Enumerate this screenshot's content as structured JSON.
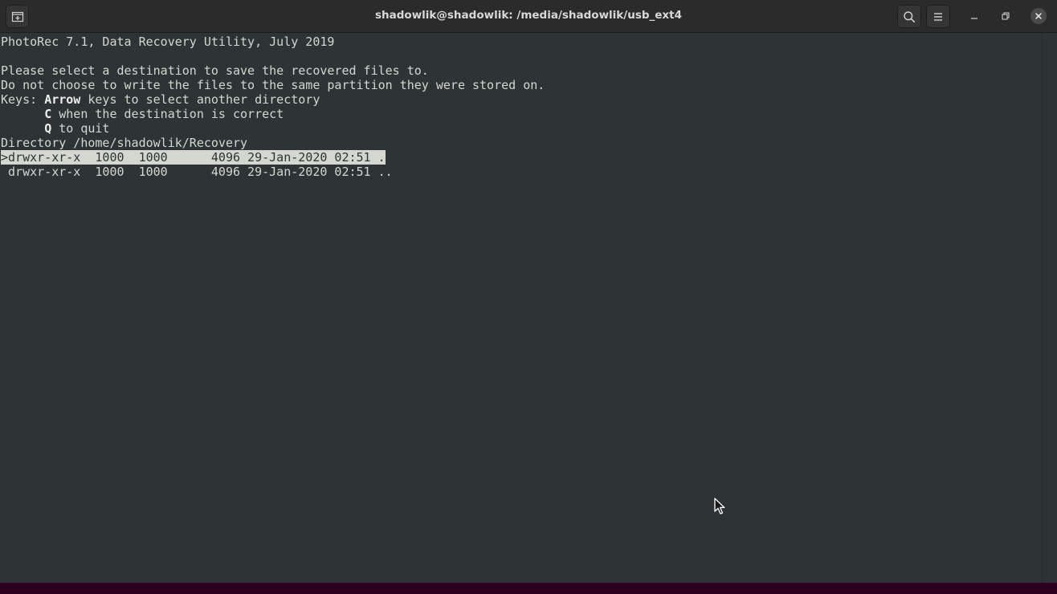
{
  "window": {
    "title": "shadowlik@shadowlik: /media/shadowlik/usb_ext4"
  },
  "icons": {
    "new_tab": "new-tab-icon",
    "search": "search-icon",
    "menu": "hamburger-menu-icon",
    "minimize": "minimize-icon",
    "maximize": "maximize-icon",
    "close": "close-icon",
    "cursor": "mouse-pointer-icon"
  },
  "colors": {
    "terminal_bg": "#2e3436",
    "terminal_fg": "#d3d7cf",
    "titlebar_bg": "#2b2b2b",
    "highlight_bg": "#d3d7cf"
  },
  "terminal": {
    "header": "PhotoRec 7.1, Data Recovery Utility, July 2019",
    "prompt_line1": "Please select a destination to save the recovered files to.",
    "prompt_line2": "Do not choose to write the files to the same partition they were stored on.",
    "keys": {
      "prefix": "Keys: ",
      "arrow_key": "Arrow",
      "arrow_desc": " keys to select another directory",
      "c_indent": "      ",
      "c_key": "C",
      "c_desc": " when the destination is correct",
      "q_indent": "      ",
      "q_key": "Q",
      "q_desc": " to quit"
    },
    "directory_line": "Directory /home/shadowlik/Recovery",
    "entries": [
      {
        "line": ">drwxr-xr-x  1000  1000      4096 29-Jan-2020 02:51 .",
        "selected": true
      },
      {
        "line": " drwxr-xr-x  1000  1000      4096 29-Jan-2020 02:51 ..",
        "selected": false
      }
    ]
  }
}
